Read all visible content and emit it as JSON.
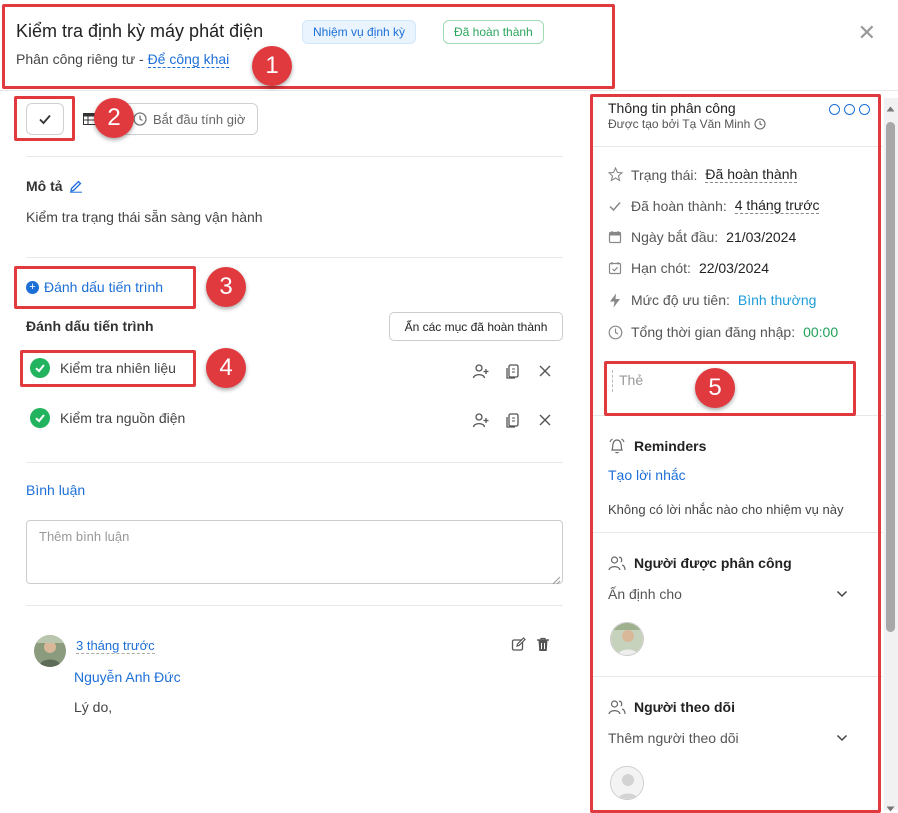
{
  "header": {
    "title": "Kiểm tra định kỳ máy phát điện",
    "badge_type": "Nhiệm vụ định kỳ",
    "badge_status": "Đã hoàn thành",
    "assign_prefix": "Phân công riêng tư -",
    "assign_link": "Để công khai"
  },
  "toolbar": {
    "start_timer": "Bắt đầu tính giờ"
  },
  "description": {
    "label": "Mô tả",
    "text": "Kiểm tra trạng thái sẵn sàng vận hành"
  },
  "progress": {
    "add_label": "Đánh dấu tiến trình",
    "section_label": "Đánh dấu tiến trình",
    "hide_completed": "Ẩn các mục đã hoàn thành",
    "items": [
      {
        "label": "Kiểm tra nhiên liệu",
        "done": true
      },
      {
        "label": "Kiểm tra nguồn điện",
        "done": true
      }
    ]
  },
  "comments": {
    "title": "Bình luận",
    "placeholder": "Thêm bình luận",
    "items": [
      {
        "time": "3 tháng trước",
        "author": "Nguyễn Anh Đức",
        "text": "Lý do,"
      }
    ]
  },
  "panel": {
    "title": "Thông tin phân công",
    "created_by": "Được tạo bởi Tạ Văn Minh",
    "status_label": "Trạng thái:",
    "status_value": "Đã hoàn thành",
    "completed_label": "Đã hoàn thành:",
    "completed_value": "4 tháng trước",
    "start_label": "Ngày bắt đầu:",
    "start_value": "21/03/2024",
    "due_label": "Hạn chót:",
    "due_value": "22/03/2024",
    "priority_label": "Mức độ ưu tiên:",
    "priority_value": "Bình thường",
    "time_label": "Tổng thời gian đăng nhập:",
    "time_value": "00:00",
    "tag_placeholder": "Thẻ",
    "reminders_title": "Reminders",
    "reminders_link": "Tạo lời nhắc",
    "reminders_empty": "Không có lời nhắc nào cho nhiệm vụ này",
    "assignees_title": "Người được phân công",
    "assignees_select": "Ấn định cho",
    "followers_title": "Người theo dõi",
    "followers_select": "Thêm người theo dõi"
  },
  "markers": [
    "1",
    "2",
    "3",
    "4",
    "5"
  ],
  "colors": {
    "accent": "#1d6fd8",
    "success": "#22b35e",
    "highlight": "#e0393e"
  }
}
